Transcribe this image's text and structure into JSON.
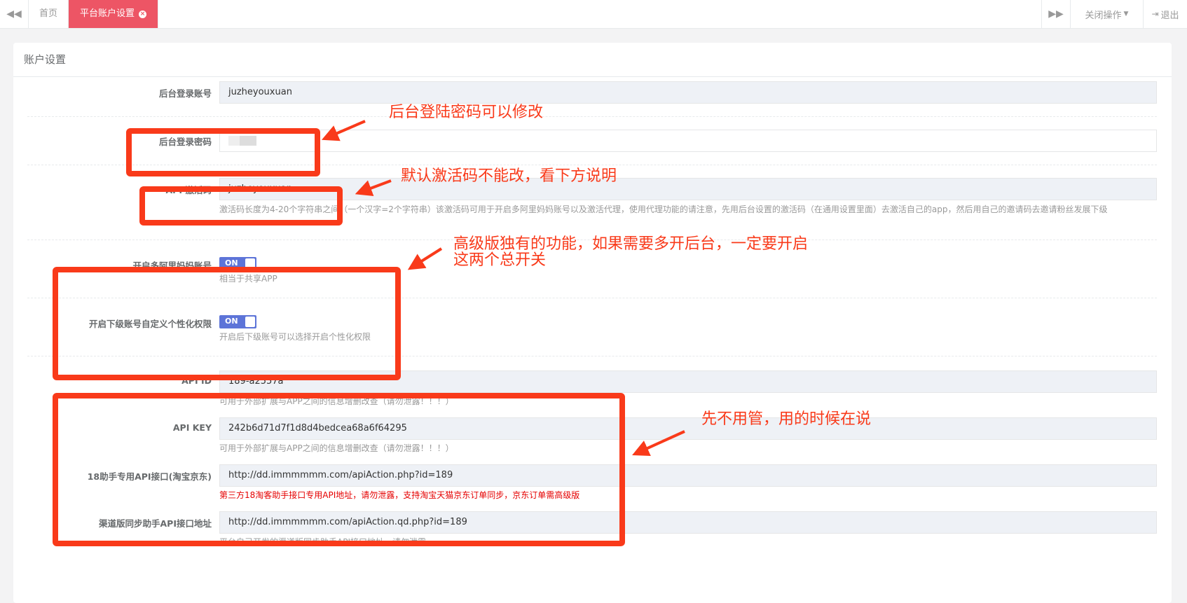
{
  "tabbar": {
    "tabs": [
      {
        "label": "首页",
        "active": false
      },
      {
        "label": "平台账户设置",
        "active": true
      }
    ],
    "close_ops_label": "关闭操作",
    "logout_label": "退出"
  },
  "panel": {
    "title": "账户设置",
    "fields": {
      "admin_account": {
        "label": "后台登录账号",
        "value": "juzheyouxuan"
      },
      "admin_password": {
        "label": "后台登录密码",
        "value": ""
      },
      "app_code": {
        "label": "APP激活码",
        "value": "juzheyouxuan",
        "help": "激活码长度为4-20个字符串之间（一个汉字=2个字符串）该激活码可用于开启多阿里妈妈账号以及激活代理，使用代理功能的请注意，先用后台设置的激活码（在通用设置里面）去激活自己的app，然后用自己的邀请码去邀请粉丝发展下级"
      },
      "multi_alimama": {
        "label": "开启多阿里妈妈账号",
        "switch": "ON",
        "help": "相当于共享APP"
      },
      "sub_custom": {
        "label": "开启下级账号自定义个性化权限",
        "switch": "ON",
        "help": "开启后下级账号可以选择开启个性化权限"
      },
      "api_id": {
        "label": "API ID",
        "value": "189-a2557a",
        "help": "可用于外部扩展与APP之间的信息增删改查（请勿泄露！！！）"
      },
      "api_key": {
        "label": "API KEY",
        "value": "242b6d71d7f1d8d4bedcea68a6f64295",
        "help": "可用于外部扩展与APP之间的信息增删改查（请勿泄露！！！）"
      },
      "api_18": {
        "label": "18助手专用API接口(淘宝京东)",
        "value": "http://dd.immmmmm.com/apiAction.php?id=189",
        "help": "第三方18淘客助手接口专用API地址，请勿泄露，支持淘宝天猫京东订单同步，京东订单需高级版"
      },
      "api_channel": {
        "label": "渠道版同步助手API接口地址",
        "value": "http://dd.immmmmm.com/apiAction.qd.php?id=189",
        "help": "平台自己开发的渠道版同步助手API接口地址，请勿泄露"
      }
    }
  },
  "annotations": {
    "password": "后台登陆密码可以修改",
    "app_code": "默认激活码不能改，看下方说明",
    "premium_line1": "高级版独有的功能，如果需要多开后台，一定要开启",
    "premium_line2": "这两个总开关",
    "api": "先不用管，用的时候在说"
  },
  "colors": {
    "accent_tab": "#ed5565",
    "switch": "#5d74d8",
    "annotation": "#f93a1a"
  },
  "icons": [
    "double-chevron-left-icon",
    "double-chevron-right-icon",
    "close-circle-icon",
    "caret-down-icon",
    "logout-icon"
  ]
}
